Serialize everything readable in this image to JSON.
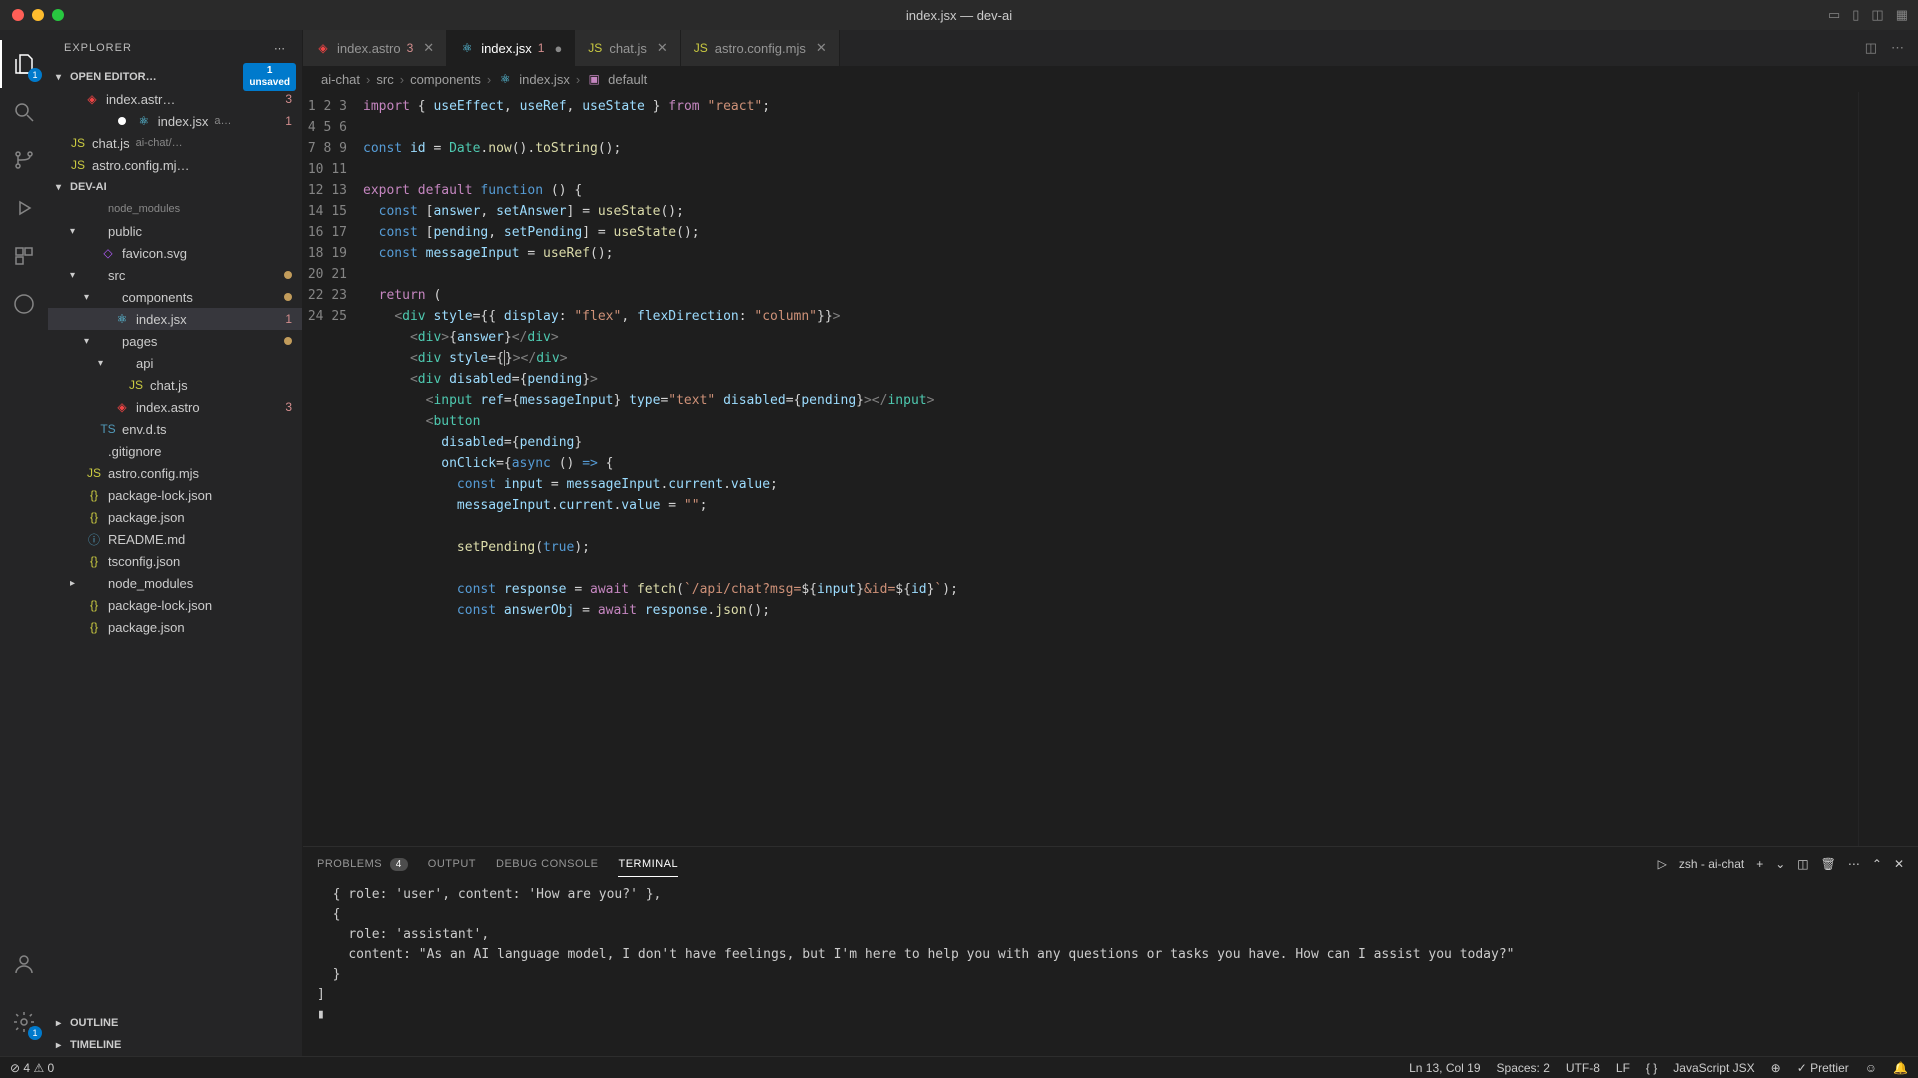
{
  "titlebar": {
    "title": "index.jsx — dev-ai"
  },
  "activity": {
    "explorer_badge": "1",
    "settings_badge": "1"
  },
  "sidebar": {
    "header": "EXPLORER",
    "openEditors": {
      "label": "OPEN EDITOR…",
      "unsaved_count": "1",
      "unsaved_label": "unsaved",
      "items": [
        {
          "name": "index.astr…",
          "badge": "3",
          "icon": "astro",
          "modified": false,
          "hasDot": true
        },
        {
          "name": "index.jsx",
          "extra": "a…",
          "badge": "1",
          "icon": "react",
          "modified": true,
          "hasDot": true
        },
        {
          "name": "chat.js",
          "extra": "ai-chat/…",
          "icon": "js"
        },
        {
          "name": "astro.config.mj…",
          "icon": "js"
        }
      ]
    },
    "project": {
      "label": "DEV-AI",
      "tree": [
        {
          "indent": 1,
          "name": "node_modules",
          "chev": "",
          "dim": true,
          "icon": ""
        },
        {
          "indent": 1,
          "name": "public",
          "chev": "▾",
          "icon": ""
        },
        {
          "indent": 2,
          "name": "favicon.svg",
          "icon": "svg"
        },
        {
          "indent": 1,
          "name": "src",
          "chev": "▾",
          "icon": "",
          "git": true
        },
        {
          "indent": 2,
          "name": "components",
          "chev": "▾",
          "icon": "",
          "git": true
        },
        {
          "indent": 3,
          "name": "index.jsx",
          "icon": "react",
          "badge": "1",
          "selected": true
        },
        {
          "indent": 2,
          "name": "pages",
          "chev": "▾",
          "icon": "",
          "git": true
        },
        {
          "indent": 3,
          "name": "api",
          "chev": "▾",
          "icon": ""
        },
        {
          "indent": 4,
          "name": "chat.js",
          "icon": "js"
        },
        {
          "indent": 3,
          "name": "index.astro",
          "icon": "astro",
          "badge": "3"
        },
        {
          "indent": 2,
          "name": "env.d.ts",
          "icon": "ts"
        },
        {
          "indent": 1,
          "name": ".gitignore",
          "icon": ""
        },
        {
          "indent": 1,
          "name": "astro.config.mjs",
          "icon": "js"
        },
        {
          "indent": 1,
          "name": "package-lock.json",
          "icon": "json"
        },
        {
          "indent": 1,
          "name": "package.json",
          "icon": "json"
        },
        {
          "indent": 1,
          "name": "README.md",
          "icon": "md"
        },
        {
          "indent": 1,
          "name": "tsconfig.json",
          "icon": "json"
        },
        {
          "indent": 1,
          "name": "node_modules",
          "chev": "▸",
          "icon": ""
        },
        {
          "indent": 1,
          "name": "package-lock.json",
          "icon": "json"
        },
        {
          "indent": 1,
          "name": "package.json",
          "icon": "json"
        }
      ]
    },
    "outline": "OUTLINE",
    "timeline": "TIMELINE"
  },
  "tabs": [
    {
      "name": "index.astro",
      "badge": "3",
      "icon": "astro"
    },
    {
      "name": "index.jsx",
      "badge": "1",
      "icon": "react",
      "active": true,
      "modified": true
    },
    {
      "name": "chat.js",
      "icon": "js"
    },
    {
      "name": "astro.config.mjs",
      "icon": "js"
    }
  ],
  "breadcrumb": [
    "ai-chat",
    "src",
    "components",
    "index.jsx",
    "default"
  ],
  "code": {
    "lines": 25
  },
  "panel": {
    "tabs": {
      "problems": "PROBLEMS",
      "problems_count": "4",
      "output": "OUTPUT",
      "debug": "DEBUG CONSOLE",
      "terminal": "TERMINAL"
    },
    "termName": "zsh - ai-chat",
    "body": "  { role: 'user', content: 'How are you?' },\n  {\n    role: 'assistant',\n    content: \"As an AI language model, I don't have feelings, but I'm here to help you with any questions or tasks you have. How can I assist you today?\"\n  }\n]\n▮"
  },
  "status": {
    "warnings": "4",
    "errors": "0",
    "position": "Ln 13, Col 19",
    "spaces": "Spaces: 2",
    "encoding": "UTF-8",
    "eol": "LF",
    "lang": "JavaScript JSX",
    "prettier": "Prettier"
  }
}
